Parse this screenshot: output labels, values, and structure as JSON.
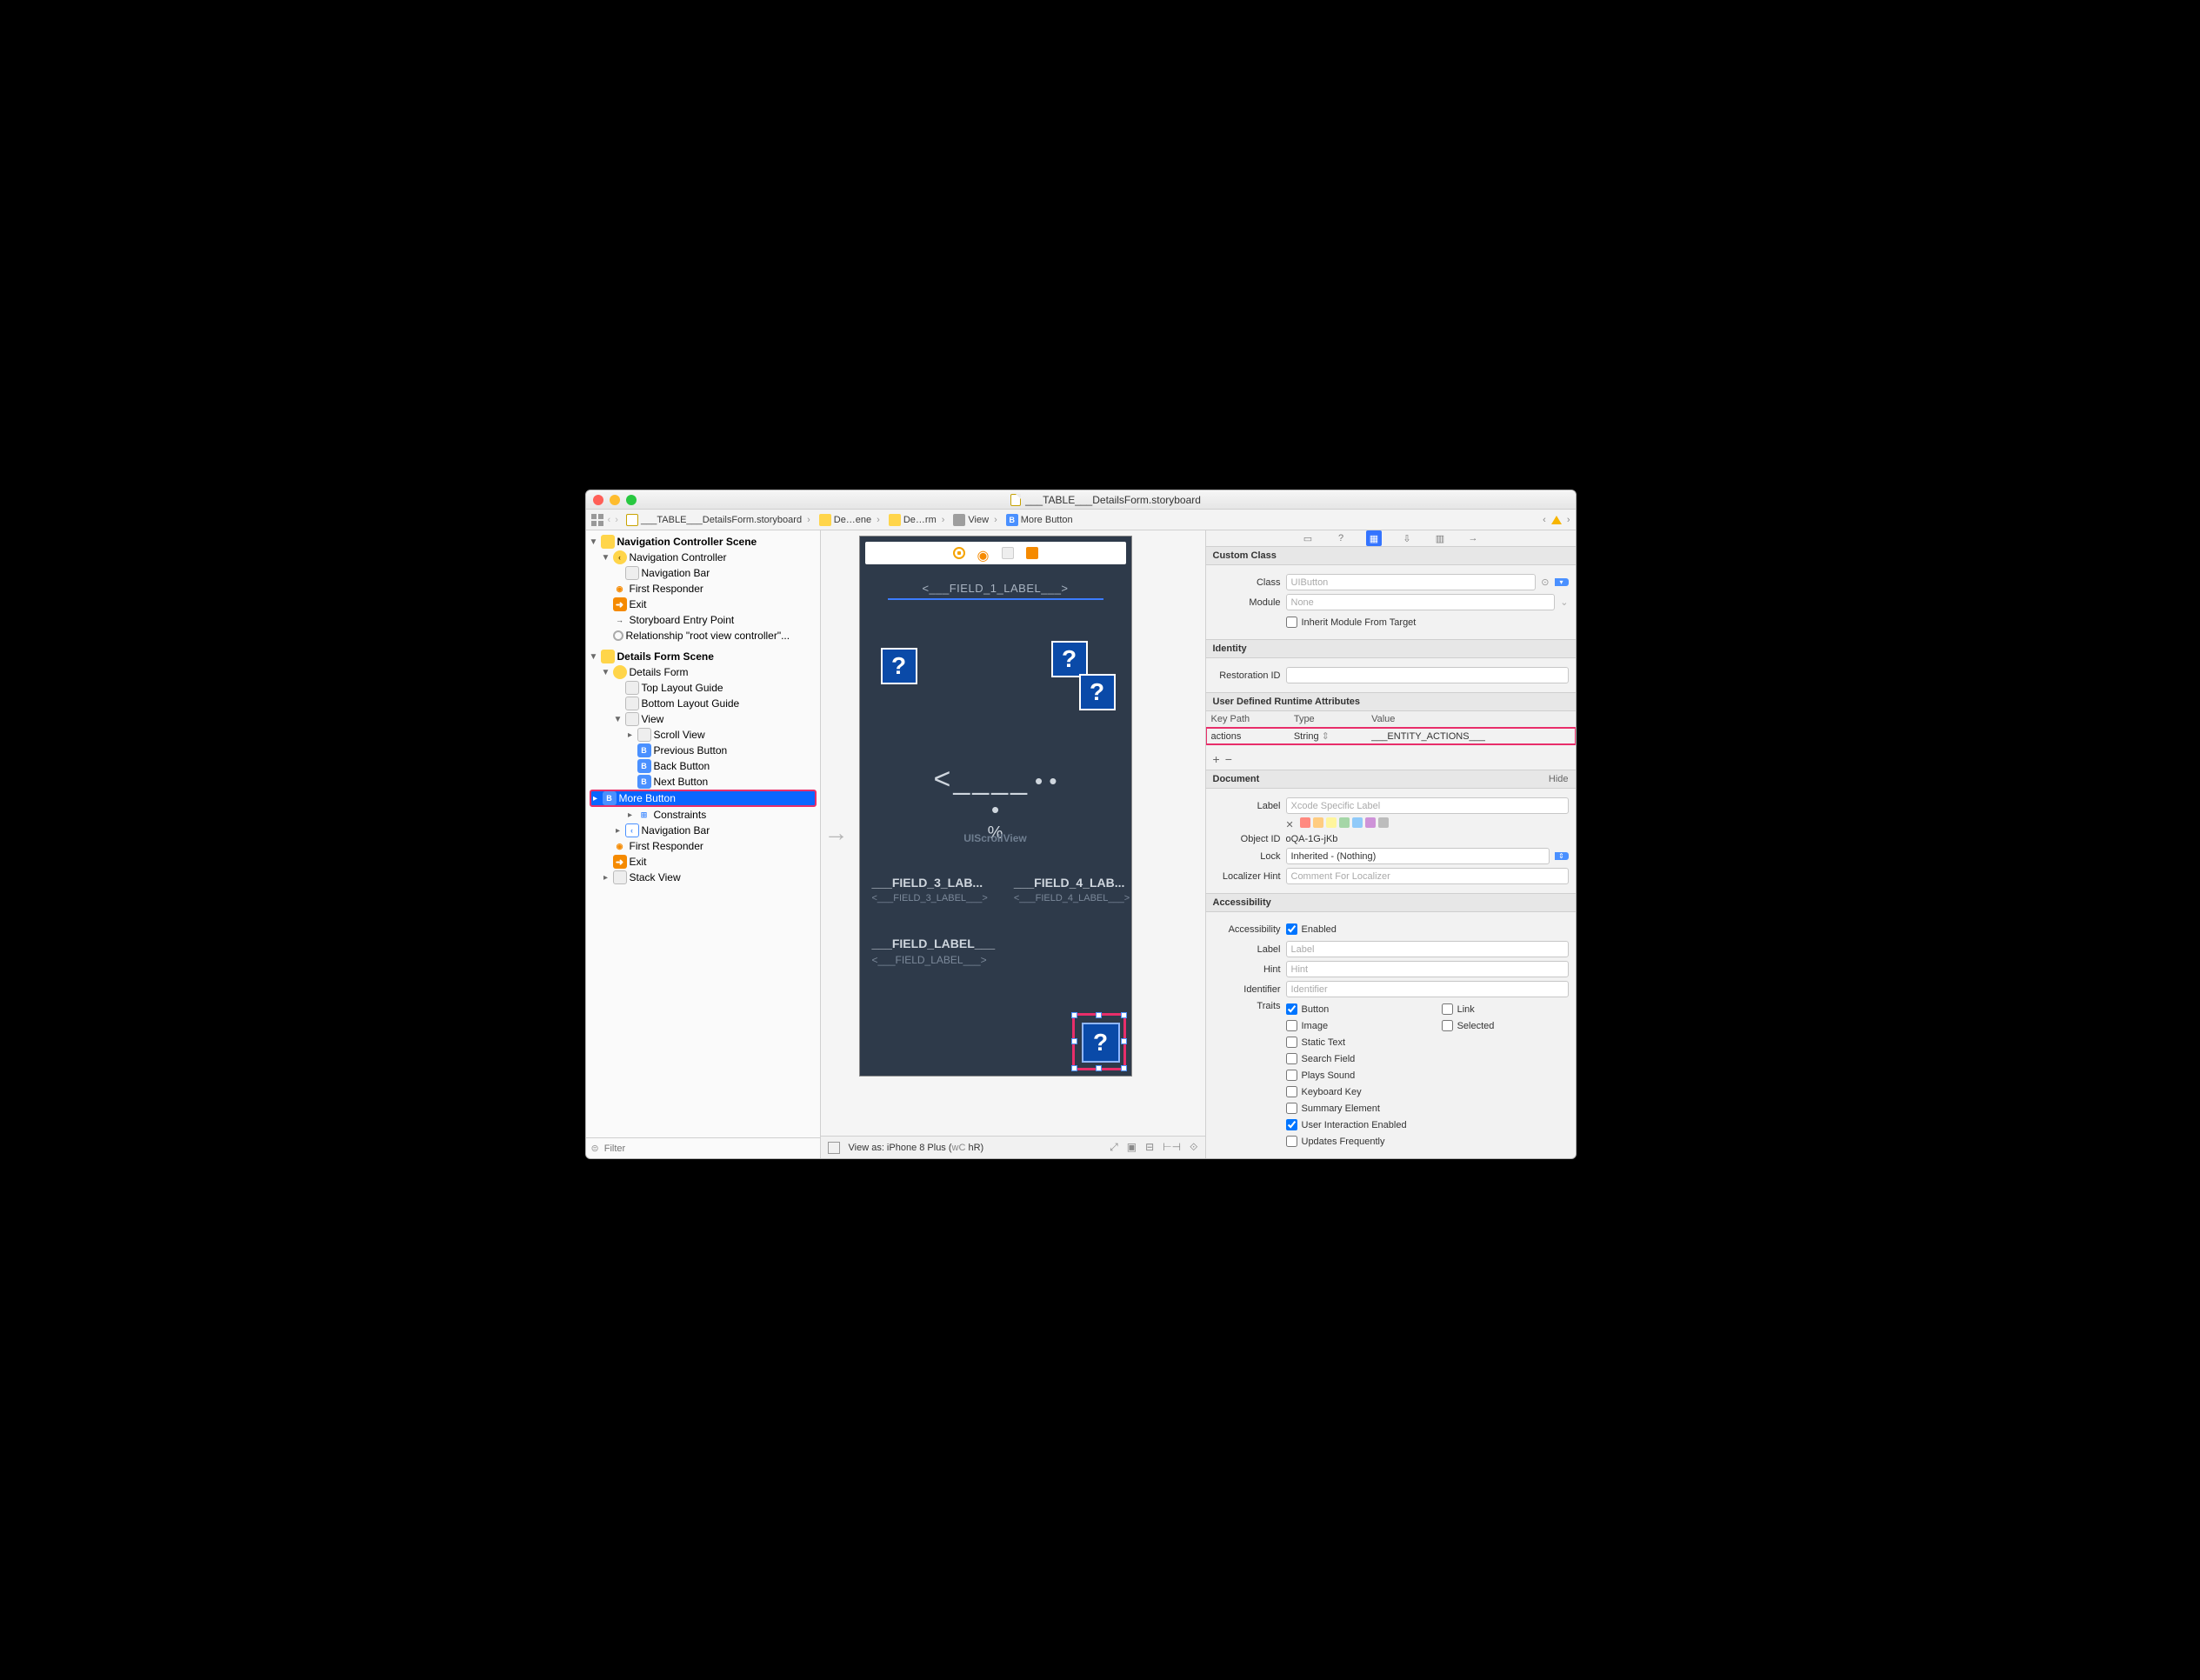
{
  "title": "___TABLE___DetailsForm.storyboard",
  "jumpbar": {
    "file": "___TABLE___DetailsForm.storyboard",
    "seg1": "De…ene",
    "seg2": "De…rm",
    "seg3": "View",
    "seg4": "More Button"
  },
  "outline": {
    "scene1": "Navigation Controller Scene",
    "nc": "Navigation Controller",
    "navbar": "Navigation Bar",
    "fr": "First Responder",
    "exit": "Exit",
    "sep": "Storyboard Entry Point",
    "rel": "Relationship \"root view controller\"...",
    "scene2": "Details Form Scene",
    "df": "Details Form",
    "tlg": "Top Layout Guide",
    "blg": "Bottom Layout Guide",
    "view": "View",
    "sv": "Scroll View",
    "pb": "Previous Button",
    "bb": "Back Button",
    "nb": "Next Button",
    "mb": "More Button",
    "cons": "Constraints",
    "nb2": "Navigation Bar",
    "fr2": "First Responder",
    "exit2": "Exit",
    "stk": "Stack View"
  },
  "filter_placeholder": "Filter",
  "canvas": {
    "field1": "<___FIELD_1_LABEL___>",
    "glyph": "<____",
    "dots": "• • •",
    "pct": "%",
    "scroll": "UIScrollView",
    "f3v": "___FIELD_3_LAB...",
    "f3l": "<___FIELD_3_LABEL___>",
    "f4v": "___FIELD_4_LAB...",
    "f4l": "<___FIELD_4_LABEL___>",
    "fv": "___FIELD_LABEL___",
    "fl": "<___FIELD_LABEL___>",
    "footer_view": "View as: iPhone 8 Plus (",
    "footer_wc": "wC",
    "footer_hr": " hR)"
  },
  "inspector": {
    "sect_customclass": "Custom Class",
    "lbl_class": "Class",
    "ph_class": "UIButton",
    "lbl_module": "Module",
    "ph_module": "None",
    "inherit": "Inherit Module From Target",
    "sect_identity": "Identity",
    "lbl_restid": "Restoration ID",
    "sect_udra": "User Defined Runtime Attributes",
    "th_keypath": "Key Path",
    "th_type": "Type",
    "th_value": "Value",
    "r_keypath": "actions",
    "r_type": "String",
    "r_value": "___ENTITY_ACTIONS___",
    "sect_document": "Document",
    "hide": "Hide",
    "lbl_label": "Label",
    "ph_label": "Xcode Specific Label",
    "lbl_objectid": "Object ID",
    "val_objectid": "oQA-1G-jKb",
    "lbl_lock": "Lock",
    "val_lock": "Inherited - (Nothing)",
    "lbl_lochint": "Localizer Hint",
    "ph_lochint": "Comment For Localizer",
    "sect_acc": "Accessibility",
    "lbl_acc": "Accessibility",
    "acc_enabled": "Enabled",
    "acc_label": "Label",
    "acc_label_ph": "Label",
    "acc_hint": "Hint",
    "acc_hint_ph": "Hint",
    "acc_ident": "Identifier",
    "acc_ident_ph": "Identifier",
    "lbl_traits": "Traits",
    "traits": {
      "button": "Button",
      "image": "Image",
      "statictext": "Static Text",
      "searchfield": "Search Field",
      "playssound": "Plays Sound",
      "keyboardkey": "Keyboard Key",
      "summary": "Summary Element",
      "uie": "User Interaction Enabled",
      "updates": "Updates Frequently",
      "link": "Link",
      "selected": "Selected"
    }
  }
}
